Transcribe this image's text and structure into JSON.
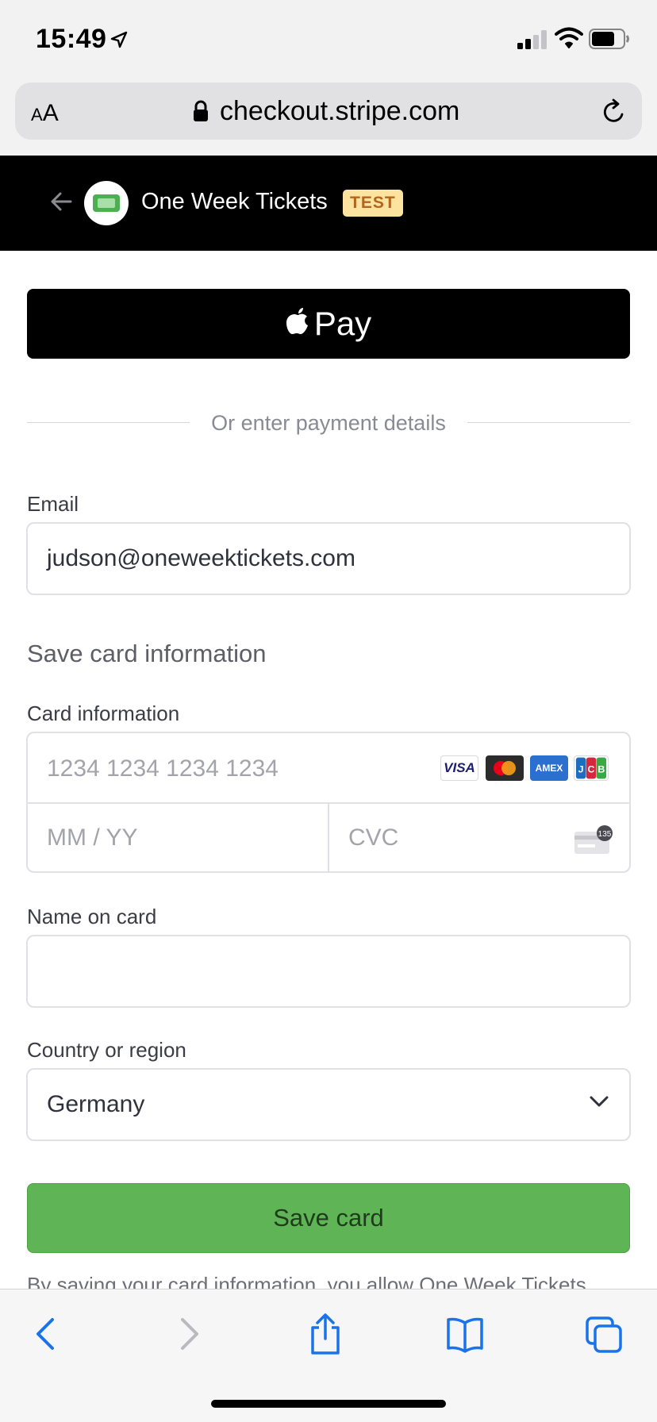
{
  "status_bar": {
    "time": "15:49",
    "icons": [
      "location-arrow-icon",
      "signal-icon",
      "wifi-icon",
      "battery-icon"
    ]
  },
  "browser": {
    "text_size_label_small": "A",
    "text_size_label_large": "A",
    "url": "checkout.stripe.com"
  },
  "merchant": {
    "name": "One Week Tickets",
    "badge": "TEST"
  },
  "apple_pay": {
    "label": "Pay"
  },
  "divider_text": "Or enter payment details",
  "email": {
    "label": "Email",
    "value": "judson@oneweektickets.com"
  },
  "section_title": "Save card information",
  "card": {
    "label": "Card information",
    "number_placeholder": "1234 1234 1234 1234",
    "expiry_placeholder": "MM / YY",
    "cvc_placeholder": "CVC",
    "brands": [
      "VISA",
      "Mastercard",
      "AMEX",
      "JCB"
    ],
    "cvc_hint": "135"
  },
  "name_on_card": {
    "label": "Name on card",
    "value": ""
  },
  "country": {
    "label": "Country or region",
    "selected": "Germany"
  },
  "submit": {
    "label": "Save card"
  },
  "legal_text": "By saving your card information, you allow One Week Tickets",
  "colors": {
    "submit_bg": "#5fb456",
    "badge_bg": "#fde3a0",
    "badge_text": "#b3651d",
    "safari_blue": "#1a73e8"
  }
}
